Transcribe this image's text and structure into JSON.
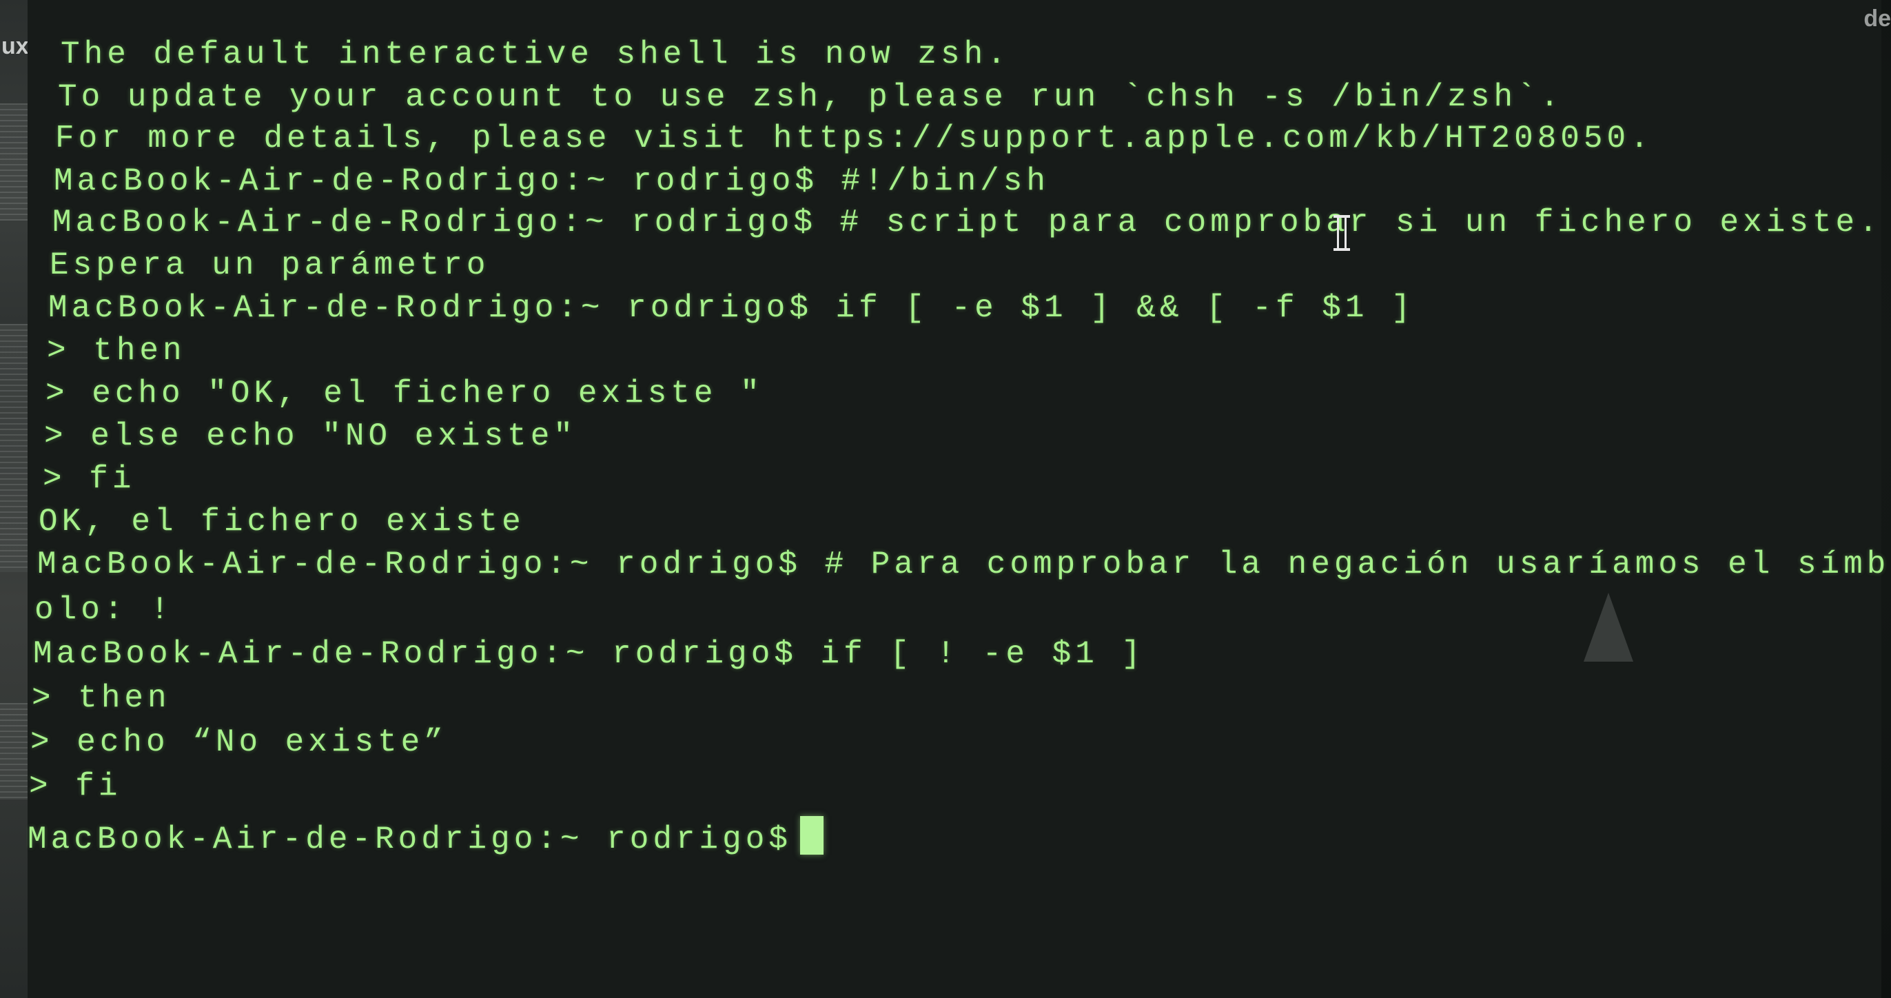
{
  "background_window": {
    "partial_text_left": "ux.p",
    "partial_text_right": "de"
  },
  "terminal": {
    "prompt": "MacBook-Air-de-Rodrigo:~ rodrigo$",
    "lines": [
      "The default interactive shell is now zsh.",
      "To update your account to use zsh, please run `chsh -s /bin/zsh`.",
      "For more details, please visit https://support.apple.com/kb/HT208050.",
      "MacBook-Air-de-Rodrigo:~ rodrigo$ #!/bin/sh",
      "MacBook-Air-de-Rodrigo:~ rodrigo$ # script para comprobar si un fichero existe.",
      "Espera un parámetro",
      "MacBook-Air-de-Rodrigo:~ rodrigo$ if [ -e $1 ] && [ -f $1 ]",
      "> then",
      "> echo \"OK, el fichero existe \"",
      "> else echo \"NO existe\"",
      "> fi",
      "OK, el fichero existe",
      "MacBook-Air-de-Rodrigo:~ rodrigo$ # Para comprobar la negación usaríamos el símb",
      "olo: !",
      "MacBook-Air-de-Rodrigo:~ rodrigo$ if [ ! -e $1 ]",
      "> then",
      "> echo “No existe”",
      "> fi"
    ],
    "current_prompt": "MacBook-Air-de-Rodrigo:~ rodrigo$",
    "colors": {
      "text": "#a6f08a",
      "background": "#171b19",
      "cursor": "#b4f59a"
    }
  }
}
